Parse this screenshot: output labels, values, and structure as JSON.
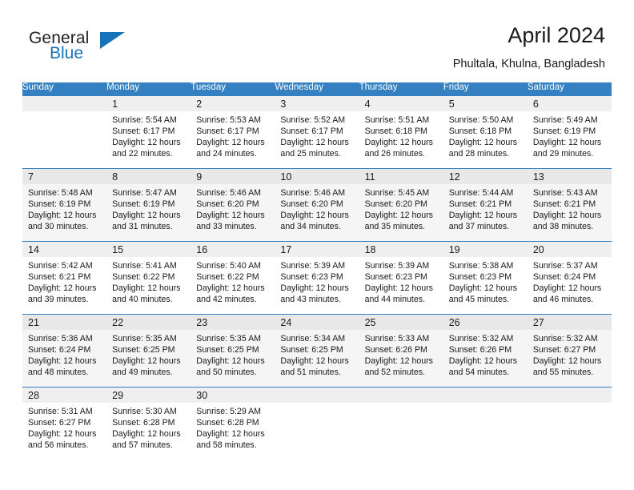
{
  "brand": {
    "name_part1": "General",
    "name_part2": "Blue",
    "triangle_icon": "triangle-icon",
    "accent_color": "#1773b8"
  },
  "header": {
    "title": "April 2024",
    "subtitle": "Phultala, Khulna, Bangladesh"
  },
  "calendar": {
    "header_bg": "#3580c0",
    "row_alt_bg": "#f5f5f5",
    "daynum_bg": "#efefef",
    "weekday_headers": [
      "Sunday",
      "Monday",
      "Tuesday",
      "Wednesday",
      "Thursday",
      "Friday",
      "Saturday"
    ],
    "weeks": [
      {
        "shaded": false,
        "days": [
          {
            "num": "",
            "sunrise": "",
            "sunset": "",
            "daylight_line1": "",
            "daylight_line2": "",
            "empty": true
          },
          {
            "num": "1",
            "sunrise": "Sunrise: 5:54 AM",
            "sunset": "Sunset: 6:17 PM",
            "daylight_line1": "Daylight: 12 hours",
            "daylight_line2": "and 22 minutes.",
            "empty": false
          },
          {
            "num": "2",
            "sunrise": "Sunrise: 5:53 AM",
            "sunset": "Sunset: 6:17 PM",
            "daylight_line1": "Daylight: 12 hours",
            "daylight_line2": "and 24 minutes.",
            "empty": false
          },
          {
            "num": "3",
            "sunrise": "Sunrise: 5:52 AM",
            "sunset": "Sunset: 6:17 PM",
            "daylight_line1": "Daylight: 12 hours",
            "daylight_line2": "and 25 minutes.",
            "empty": false
          },
          {
            "num": "4",
            "sunrise": "Sunrise: 5:51 AM",
            "sunset": "Sunset: 6:18 PM",
            "daylight_line1": "Daylight: 12 hours",
            "daylight_line2": "and 26 minutes.",
            "empty": false
          },
          {
            "num": "5",
            "sunrise": "Sunrise: 5:50 AM",
            "sunset": "Sunset: 6:18 PM",
            "daylight_line1": "Daylight: 12 hours",
            "daylight_line2": "and 28 minutes.",
            "empty": false
          },
          {
            "num": "6",
            "sunrise": "Sunrise: 5:49 AM",
            "sunset": "Sunset: 6:19 PM",
            "daylight_line1": "Daylight: 12 hours",
            "daylight_line2": "and 29 minutes.",
            "empty": false
          }
        ]
      },
      {
        "shaded": true,
        "days": [
          {
            "num": "7",
            "sunrise": "Sunrise: 5:48 AM",
            "sunset": "Sunset: 6:19 PM",
            "daylight_line1": "Daylight: 12 hours",
            "daylight_line2": "and 30 minutes.",
            "empty": false
          },
          {
            "num": "8",
            "sunrise": "Sunrise: 5:47 AM",
            "sunset": "Sunset: 6:19 PM",
            "daylight_line1": "Daylight: 12 hours",
            "daylight_line2": "and 31 minutes.",
            "empty": false
          },
          {
            "num": "9",
            "sunrise": "Sunrise: 5:46 AM",
            "sunset": "Sunset: 6:20 PM",
            "daylight_line1": "Daylight: 12 hours",
            "daylight_line2": "and 33 minutes.",
            "empty": false
          },
          {
            "num": "10",
            "sunrise": "Sunrise: 5:46 AM",
            "sunset": "Sunset: 6:20 PM",
            "daylight_line1": "Daylight: 12 hours",
            "daylight_line2": "and 34 minutes.",
            "empty": false
          },
          {
            "num": "11",
            "sunrise": "Sunrise: 5:45 AM",
            "sunset": "Sunset: 6:20 PM",
            "daylight_line1": "Daylight: 12 hours",
            "daylight_line2": "and 35 minutes.",
            "empty": false
          },
          {
            "num": "12",
            "sunrise": "Sunrise: 5:44 AM",
            "sunset": "Sunset: 6:21 PM",
            "daylight_line1": "Daylight: 12 hours",
            "daylight_line2": "and 37 minutes.",
            "empty": false
          },
          {
            "num": "13",
            "sunrise": "Sunrise: 5:43 AM",
            "sunset": "Sunset: 6:21 PM",
            "daylight_line1": "Daylight: 12 hours",
            "daylight_line2": "and 38 minutes.",
            "empty": false
          }
        ]
      },
      {
        "shaded": false,
        "days": [
          {
            "num": "14",
            "sunrise": "Sunrise: 5:42 AM",
            "sunset": "Sunset: 6:21 PM",
            "daylight_line1": "Daylight: 12 hours",
            "daylight_line2": "and 39 minutes.",
            "empty": false
          },
          {
            "num": "15",
            "sunrise": "Sunrise: 5:41 AM",
            "sunset": "Sunset: 6:22 PM",
            "daylight_line1": "Daylight: 12 hours",
            "daylight_line2": "and 40 minutes.",
            "empty": false
          },
          {
            "num": "16",
            "sunrise": "Sunrise: 5:40 AM",
            "sunset": "Sunset: 6:22 PM",
            "daylight_line1": "Daylight: 12 hours",
            "daylight_line2": "and 42 minutes.",
            "empty": false
          },
          {
            "num": "17",
            "sunrise": "Sunrise: 5:39 AM",
            "sunset": "Sunset: 6:23 PM",
            "daylight_line1": "Daylight: 12 hours",
            "daylight_line2": "and 43 minutes.",
            "empty": false
          },
          {
            "num": "18",
            "sunrise": "Sunrise: 5:39 AM",
            "sunset": "Sunset: 6:23 PM",
            "daylight_line1": "Daylight: 12 hours",
            "daylight_line2": "and 44 minutes.",
            "empty": false
          },
          {
            "num": "19",
            "sunrise": "Sunrise: 5:38 AM",
            "sunset": "Sunset: 6:23 PM",
            "daylight_line1": "Daylight: 12 hours",
            "daylight_line2": "and 45 minutes.",
            "empty": false
          },
          {
            "num": "20",
            "sunrise": "Sunrise: 5:37 AM",
            "sunset": "Sunset: 6:24 PM",
            "daylight_line1": "Daylight: 12 hours",
            "daylight_line2": "and 46 minutes.",
            "empty": false
          }
        ]
      },
      {
        "shaded": true,
        "days": [
          {
            "num": "21",
            "sunrise": "Sunrise: 5:36 AM",
            "sunset": "Sunset: 6:24 PM",
            "daylight_line1": "Daylight: 12 hours",
            "daylight_line2": "and 48 minutes.",
            "empty": false
          },
          {
            "num": "22",
            "sunrise": "Sunrise: 5:35 AM",
            "sunset": "Sunset: 6:25 PM",
            "daylight_line1": "Daylight: 12 hours",
            "daylight_line2": "and 49 minutes.",
            "empty": false
          },
          {
            "num": "23",
            "sunrise": "Sunrise: 5:35 AM",
            "sunset": "Sunset: 6:25 PM",
            "daylight_line1": "Daylight: 12 hours",
            "daylight_line2": "and 50 minutes.",
            "empty": false
          },
          {
            "num": "24",
            "sunrise": "Sunrise: 5:34 AM",
            "sunset": "Sunset: 6:25 PM",
            "daylight_line1": "Daylight: 12 hours",
            "daylight_line2": "and 51 minutes.",
            "empty": false
          },
          {
            "num": "25",
            "sunrise": "Sunrise: 5:33 AM",
            "sunset": "Sunset: 6:26 PM",
            "daylight_line1": "Daylight: 12 hours",
            "daylight_line2": "and 52 minutes.",
            "empty": false
          },
          {
            "num": "26",
            "sunrise": "Sunrise: 5:32 AM",
            "sunset": "Sunset: 6:26 PM",
            "daylight_line1": "Daylight: 12 hours",
            "daylight_line2": "and 54 minutes.",
            "empty": false
          },
          {
            "num": "27",
            "sunrise": "Sunrise: 5:32 AM",
            "sunset": "Sunset: 6:27 PM",
            "daylight_line1": "Daylight: 12 hours",
            "daylight_line2": "and 55 minutes.",
            "empty": false
          }
        ]
      },
      {
        "shaded": false,
        "days": [
          {
            "num": "28",
            "sunrise": "Sunrise: 5:31 AM",
            "sunset": "Sunset: 6:27 PM",
            "daylight_line1": "Daylight: 12 hours",
            "daylight_line2": "and 56 minutes.",
            "empty": false
          },
          {
            "num": "29",
            "sunrise": "Sunrise: 5:30 AM",
            "sunset": "Sunset: 6:28 PM",
            "daylight_line1": "Daylight: 12 hours",
            "daylight_line2": "and 57 minutes.",
            "empty": false
          },
          {
            "num": "30",
            "sunrise": "Sunrise: 5:29 AM",
            "sunset": "Sunset: 6:28 PM",
            "daylight_line1": "Daylight: 12 hours",
            "daylight_line2": "and 58 minutes.",
            "empty": false
          },
          {
            "num": "",
            "sunrise": "",
            "sunset": "",
            "daylight_line1": "",
            "daylight_line2": "",
            "empty": true
          },
          {
            "num": "",
            "sunrise": "",
            "sunset": "",
            "daylight_line1": "",
            "daylight_line2": "",
            "empty": true
          },
          {
            "num": "",
            "sunrise": "",
            "sunset": "",
            "daylight_line1": "",
            "daylight_line2": "",
            "empty": true
          },
          {
            "num": "",
            "sunrise": "",
            "sunset": "",
            "daylight_line1": "",
            "daylight_line2": "",
            "empty": true
          }
        ]
      }
    ]
  }
}
